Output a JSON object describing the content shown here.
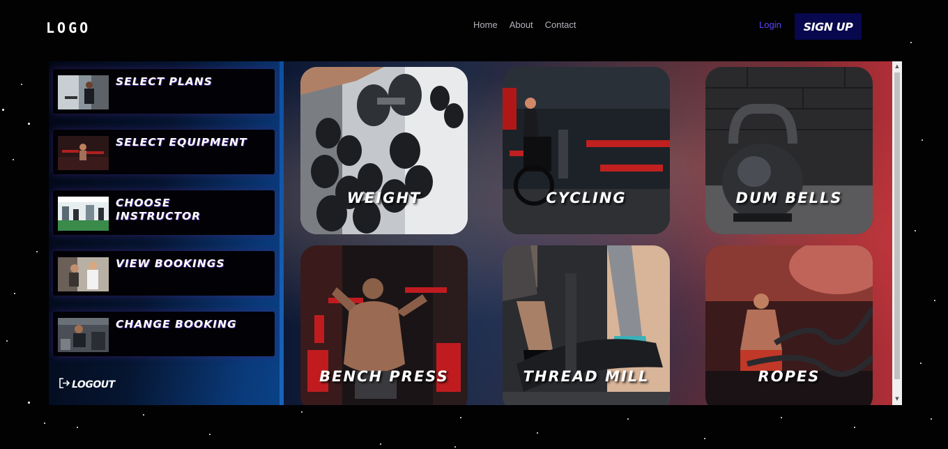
{
  "header": {
    "logo": "LOGO",
    "nav": [
      "Home",
      "About",
      "Contact"
    ],
    "login": "Login",
    "signup": "SIGN UP"
  },
  "sidebar": {
    "items": [
      {
        "label": "SELECT PLANS",
        "icon": "trainer-photo"
      },
      {
        "label": "SELECT EQUIPMENT",
        "icon": "equipment-photo"
      },
      {
        "label": "CHOOSE INSTRUCTOR",
        "icon": "gym-room-photo"
      },
      {
        "label": "VIEW BOOKINGS",
        "icon": "booking-photo"
      },
      {
        "label": "CHANGE BOOKING",
        "icon": "gym-photo"
      }
    ],
    "logout": "LOGOUT"
  },
  "cards": [
    {
      "label": "WEIGHT",
      "image": "dumbbell-rack-photo"
    },
    {
      "label": "CYCLING",
      "image": "cycling-gym-photo"
    },
    {
      "label": "DUM BELLS",
      "image": "kettlebell-photo"
    },
    {
      "label": "BENCH PRESS",
      "image": "muscular-back-photo"
    },
    {
      "label": "THREAD MILL",
      "image": "elliptical-photo"
    },
    {
      "label": "ROPES",
      "image": "battle-ropes-photo"
    }
  ],
  "colors": {
    "background": "#020203",
    "signup_bg": "#08084e",
    "login_text": "#5b45ff",
    "sidebar_accent": "#0a4288",
    "gallery_accent": "#b02e36"
  }
}
